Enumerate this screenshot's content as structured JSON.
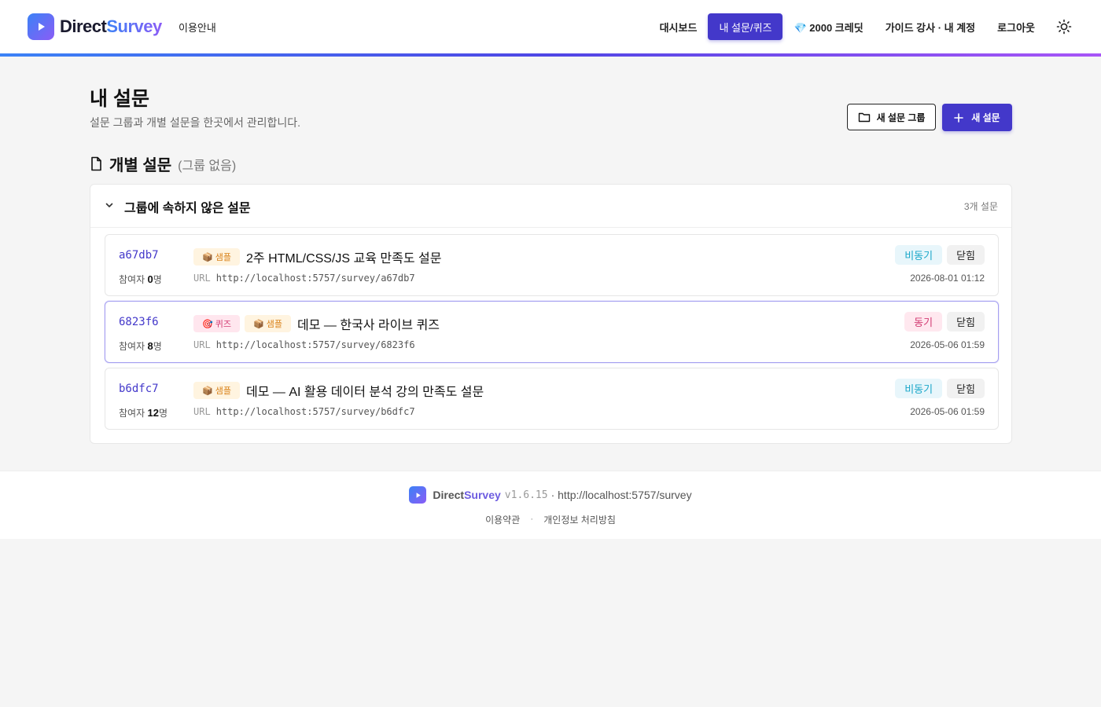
{
  "header": {
    "brand_direct": "Direct",
    "brand_survey": "Survey",
    "guide_link": "이용안내",
    "nav": [
      {
        "label": "대시보드",
        "active": false
      },
      {
        "label": "내 설문/퀴즈",
        "active": true
      },
      {
        "label": "💎 2000 크레딧",
        "active": false
      },
      {
        "label": "가이드 강사 · 내 계정",
        "active": false
      },
      {
        "label": "로그아웃",
        "active": false
      }
    ],
    "theme_icon": "sun-icon",
    "accent_color": "#4338ca"
  },
  "main": {
    "title": "내 설문",
    "subtitle": "설문 그룹과 개별 설문을 한곳에서 관리합니다.",
    "new_group_label": "새 설문 그룹",
    "new_survey_label": "새 설문",
    "section_title": "개별 설문",
    "section_note": "(그룹 없음)",
    "panel_title": "그룹에 속하지 않은 설문",
    "panel_count": "3개 설문",
    "surveys": [
      {
        "id": "a67db7",
        "participants_prefix": "참여자 ",
        "participants": "0",
        "participants_suffix": "명",
        "tags": [
          {
            "label": "📦 샘플",
            "kind": "sample"
          }
        ],
        "title": "2주 HTML/CSS/JS 교육 만족도 설문",
        "url_label": "URL",
        "url": "http://localhost:5757/survey/a67db7",
        "mode": "비동기",
        "mode_kind": "async",
        "status": "닫힘",
        "date": "2026-08-01 01:12",
        "selected": false
      },
      {
        "id": "6823f6",
        "participants_prefix": "참여자 ",
        "participants": "8",
        "participants_suffix": "명",
        "tags": [
          {
            "label": "🎯 퀴즈",
            "kind": "quiz"
          },
          {
            "label": "📦 샘플",
            "kind": "sample"
          }
        ],
        "title": "데모 — 한국사 라이브 퀴즈",
        "url_label": "URL",
        "url": "http://localhost:5757/survey/6823f6",
        "mode": "동기",
        "mode_kind": "sync",
        "status": "닫힘",
        "date": "2026-05-06 01:59",
        "selected": true
      },
      {
        "id": "b6dfc7",
        "participants_prefix": "참여자 ",
        "participants": "12",
        "participants_suffix": "명",
        "tags": [
          {
            "label": "📦 샘플",
            "kind": "sample"
          }
        ],
        "title": "데모 — AI 활용 데이터 분석 강의 만족도 설문",
        "url_label": "URL",
        "url": "http://localhost:5757/survey/b6dfc7",
        "mode": "비동기",
        "mode_kind": "async",
        "status": "닫힘",
        "date": "2026-05-06 01:59",
        "selected": false
      }
    ]
  },
  "footer": {
    "brand_direct": "Direct",
    "brand_survey": "Survey",
    "version": "v1.6.15",
    "url": "· http://localhost:5757/survey",
    "links": [
      "이용약관",
      "개인정보 처리방침"
    ],
    "separator": "·"
  }
}
